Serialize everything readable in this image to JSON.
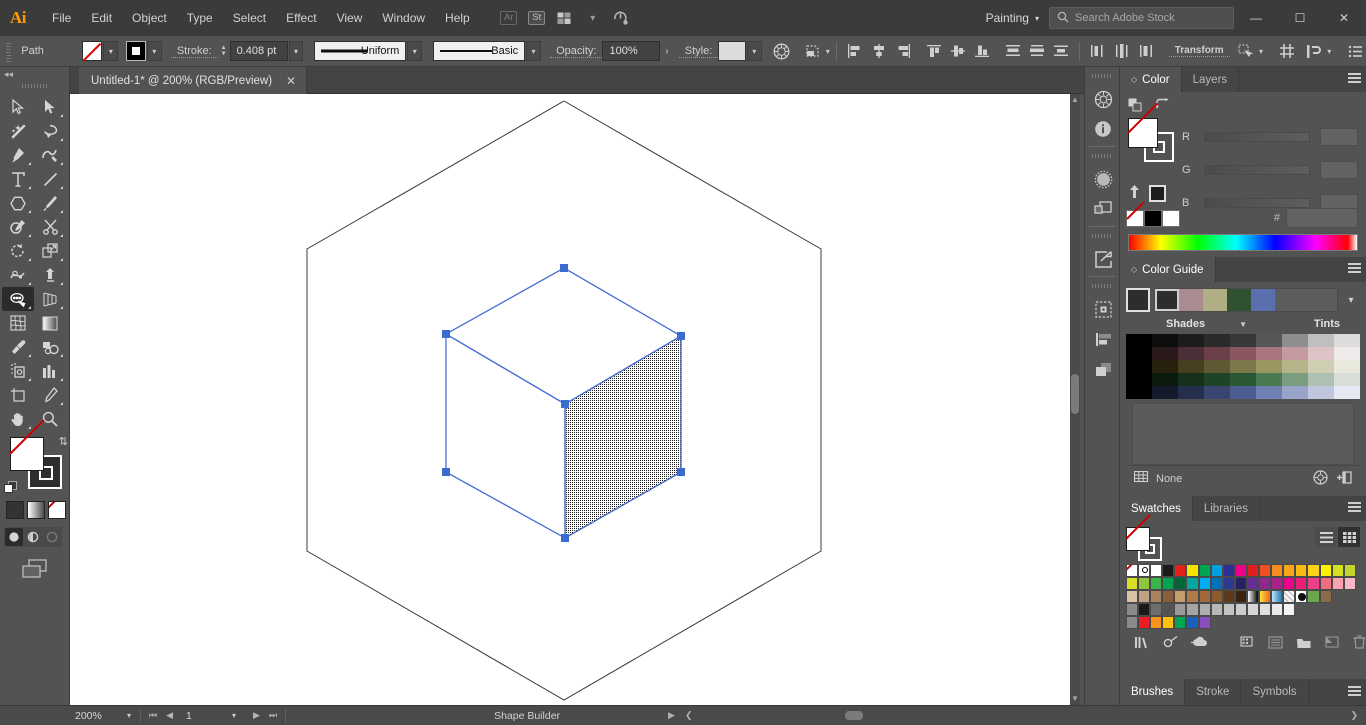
{
  "app": {
    "logo": "Ai",
    "menus": [
      "File",
      "Edit",
      "Object",
      "Type",
      "Select",
      "Effect",
      "View",
      "Window",
      "Help"
    ],
    "menubar_icons": [
      "Ar",
      "St",
      "arrange-documents-icon",
      "chevron-down-icon",
      "sync-settings-icon"
    ],
    "workspace": "Painting",
    "workspace_caret": "chevron-down-icon",
    "search_placeholder": "Search Adobe Stock",
    "search_icon": "search-icon",
    "window_buttons": {
      "minimize": "—",
      "maximize": "☐",
      "close": "✕"
    }
  },
  "control_bar": {
    "selection_label": "Path",
    "fill_swatch": "none",
    "stroke_swatch": "black",
    "stroke_label": "Stroke:",
    "stroke_weight": "0.408 pt",
    "profile": "Uniform",
    "brush": "Basic",
    "opacity_label": "Opacity:",
    "opacity_value": "100%",
    "style_label": "Style:",
    "recolor_icon": "recolor-artwork-icon",
    "transform_label": "Transform",
    "icons": [
      "shape-transform-icon",
      "align-left-icon",
      "align-center-h-icon",
      "align-right-icon",
      "align-top-icon",
      "align-middle-v-icon",
      "align-bottom-icon",
      "distribute-top-icon",
      "distribute-center-icon",
      "distribute-bottom-icon",
      "distribute-left-icon",
      "distribute-center-h-icon",
      "distribute-right-icon",
      "isolation-icon",
      "arrange-icon",
      "options-menu-icon"
    ]
  },
  "document": {
    "tab_title": "Untitled-1* @ 200% (RGB/Preview)",
    "close_icon": "close-icon"
  },
  "toolbar": {
    "collapse_icon": "collapse-panel-icon",
    "tools": [
      {
        "name": "selection-tool",
        "glyph": "arrow-outline"
      },
      {
        "name": "direct-selection-tool",
        "glyph": "arrow-solid"
      },
      {
        "name": "magic-wand-tool",
        "glyph": "wand"
      },
      {
        "name": "lasso-tool",
        "glyph": "lasso"
      },
      {
        "name": "pen-tool",
        "glyph": "pen"
      },
      {
        "name": "curvature-tool",
        "glyph": "curvature"
      },
      {
        "name": "type-tool",
        "glyph": "type"
      },
      {
        "name": "line-segment-tool",
        "glyph": "line"
      },
      {
        "name": "shape-tool",
        "glyph": "polygon"
      },
      {
        "name": "paintbrush-tool",
        "glyph": "brush"
      },
      {
        "name": "shaper-tool",
        "glyph": "shaper"
      },
      {
        "name": "scissors-tool",
        "glyph": "scissors"
      },
      {
        "name": "rotate-tool",
        "glyph": "rotate"
      },
      {
        "name": "scale-tool",
        "glyph": "scale"
      },
      {
        "name": "width-tool",
        "glyph": "width"
      },
      {
        "name": "free-transform-tool",
        "glyph": "freetransform"
      },
      {
        "name": "shape-builder-tool",
        "glyph": "shapebuilder",
        "active": true
      },
      {
        "name": "perspective-grid-tool",
        "glyph": "perspective"
      },
      {
        "name": "mesh-tool",
        "glyph": "mesh"
      },
      {
        "name": "gradient-tool",
        "glyph": "gradient"
      },
      {
        "name": "eyedropper-tool",
        "glyph": "eyedropper"
      },
      {
        "name": "blend-tool",
        "glyph": "blend"
      },
      {
        "name": "symbol-sprayer-tool",
        "glyph": "sprayer"
      },
      {
        "name": "column-graph-tool",
        "glyph": "graph"
      },
      {
        "name": "artboard-tool",
        "glyph": "artboard"
      },
      {
        "name": "slice-tool",
        "glyph": "slice"
      },
      {
        "name": "hand-tool",
        "glyph": "hand"
      },
      {
        "name": "zoom-tool",
        "glyph": "zoom"
      }
    ],
    "fill_stroke": {
      "fill": "none",
      "stroke": "black",
      "swap_icon": "swap-fill-stroke-icon",
      "default_icon": "default-fill-stroke-icon"
    },
    "color_modes": [
      "color-mode-icon",
      "gradient-mode-icon",
      "none-mode-icon"
    ],
    "draw_modes": [
      "draw-normal-icon",
      "draw-behind-icon",
      "draw-inside-icon"
    ],
    "screen_mode": "change-screen-mode-icon"
  },
  "artwork": {
    "description": "isometric cube with hatched right face inside hexagonal perspective grid",
    "selection_color": "#4a6fd4",
    "anchor_color": "#3a6bd0",
    "stroke_color": "#1a1a1a"
  },
  "panels": {
    "top_group": {
      "tabs": [
        {
          "label": "Color",
          "active": true,
          "icon": "panel-diamond-icon"
        },
        {
          "label": "Layers",
          "active": false
        }
      ],
      "menu_icon": "panel-menu-icon"
    },
    "color": {
      "fill_stroke_icons": [
        "fill-stroke-icon",
        "swap-arrow-icon"
      ],
      "channels": [
        {
          "label": "R",
          "value": ""
        },
        {
          "label": "G",
          "value": ""
        },
        {
          "label": "B",
          "value": ""
        }
      ],
      "hash_label": "#",
      "hash_value": "",
      "mini_swatches": [
        "none",
        "#000000",
        "#ffffff"
      ],
      "up_icon": "add-to-swatches-icon",
      "black_swatch": "#1d1d1d",
      "spectrum": "color-spectrum-ramp"
    },
    "color_guide": {
      "tab_label": "Color Guide",
      "menu_icon": "panel-menu-icon",
      "base_color": "#2d2d2d",
      "harmony_strip": [
        "#2d2d2d",
        "#a98b91",
        "#b0ae84",
        "#2f5233",
        "#5a6fae"
      ],
      "caret_icon": "chevron-down-icon",
      "shades_label": "Shades",
      "tints_label": "Tints",
      "arrow_icon": "dropdown-arrow-icon",
      "grid": [
        [
          "#000000",
          "#0e0e0e",
          "#1c1c1c",
          "#2b2b2b",
          "#383838",
          "#565656",
          "#8e8e8e",
          "#bfbfbf",
          "#dcdcdc"
        ],
        [
          "#000000",
          "#2b1a1c",
          "#4a3036",
          "#6b4049",
          "#8a5660",
          "#a8757d",
          "#c49aa1",
          "#ddc2c6",
          "#eeeaea"
        ],
        [
          "#000000",
          "#28210f",
          "#46401f",
          "#5f5a33",
          "#7c784a",
          "#999662",
          "#b5b388",
          "#cfceb2",
          "#e8e8dc"
        ],
        [
          "#000000",
          "#0a1a0d",
          "#16301b",
          "#1f4327",
          "#2b5834",
          "#4a7a52",
          "#7a9d80",
          "#aec0b1",
          "#d8ddd8"
        ],
        [
          "#000000",
          "#151a2b",
          "#262e4d",
          "#39456e",
          "#4e5d91",
          "#7180b2",
          "#9aa4c8",
          "#c0c6dd",
          "#e6e9f2"
        ]
      ],
      "footer_label": "None",
      "footer_icons": [
        "color-group-icon",
        "edit-colors-icon",
        "save-color-group-icon"
      ]
    },
    "swatches": {
      "tabs": [
        {
          "label": "Swatches",
          "active": true
        },
        {
          "label": "Libraries",
          "active": false
        }
      ],
      "menu_icon": "panel-menu-icon",
      "view_icons": [
        "list-view-icon",
        "grid-view-icon"
      ],
      "rows": [
        [
          "none",
          "registration",
          "#ffffff",
          "#1a1a1a",
          "#e2231a",
          "#f5e500",
          "#00a650",
          "#00a0e3",
          "#2e3192",
          "#ed008c",
          "#e02020",
          "#f04e23",
          "#f68b1f",
          "#f9a51a",
          "#fdb913",
          "#fcd116",
          "#fff200",
          "#d7df23",
          "#c3d42f"
        ],
        [
          "#d7df23",
          "#8dc63f",
          "#39b54a",
          "#00a651",
          "#006838",
          "#00a79d",
          "#00aeef",
          "#0072bc",
          "#2b3990",
          "#262262",
          "#662d91",
          "#92278f",
          "#a9218e",
          "#ec008c",
          "#ed1e79",
          "#ee3f8a",
          "#f26d7d",
          "#f9a2b0",
          "#fbb9c7"
        ],
        [
          "#d9c3a5",
          "#c1a184",
          "#a9825f",
          "#8b5e3c",
          "#c69c6d",
          "#b07b4a",
          "#a06a3a",
          "#8c5a2b",
          "#5c3a1a",
          "#gradient-white-black",
          "#gradient-orange",
          "#gradient-blue",
          "#pattern-dots",
          "#pattern-checker",
          "#pattern-leaves",
          "#pattern-grass"
        ],
        [
          "#folder",
          "#1a1a1a",
          "#6e6e6e",
          "",
          "#9a9a9a",
          "#a8a8a8",
          "#b4b4b4",
          "#c0c0c0",
          "#cacaca",
          "#d4d4d4",
          "#dedede",
          "#e8e8e8",
          "#f2f2f2",
          "#fafafa"
        ],
        [
          "#folder",
          "#ed1c24",
          "#f7941e",
          "#ffc20e",
          "#00a651",
          "#1b5fbc",
          "#8a4fbe"
        ]
      ],
      "footer_icons": [
        "swatch-libraries-icon",
        "link-icon",
        "cloud-icon",
        "show-swatch-kinds-icon",
        "swatch-options-icon",
        "new-color-group-icon",
        "new-swatch-icon",
        "delete-swatch-icon"
      ]
    },
    "bottom_group": {
      "tabs": [
        {
          "label": "Brushes",
          "active": true
        },
        {
          "label": "Stroke",
          "active": false
        },
        {
          "label": "Symbols",
          "active": false
        }
      ],
      "menu_icon": "panel-menu-icon"
    },
    "rail_icons": [
      "color-wheel-icon",
      "info-icon",
      "appearance-icon",
      "layers-stack-icon",
      "export-icon",
      "artboards-icon",
      "align-panel-icon",
      "pathfinder-icon"
    ]
  },
  "status_bar": {
    "zoom": "200%",
    "zoom_caret": "chevron-down-icon",
    "first_icon": "first-artboard-icon",
    "prev_icon": "prev-artboard-icon",
    "page": "1",
    "page_caret": "chevron-down-icon",
    "next_icon": "next-artboard-icon",
    "last_icon": "last-artboard-icon",
    "tool_name": "Shape Builder",
    "play_icon": "status-play-icon",
    "back_icon": "status-back-icon"
  }
}
